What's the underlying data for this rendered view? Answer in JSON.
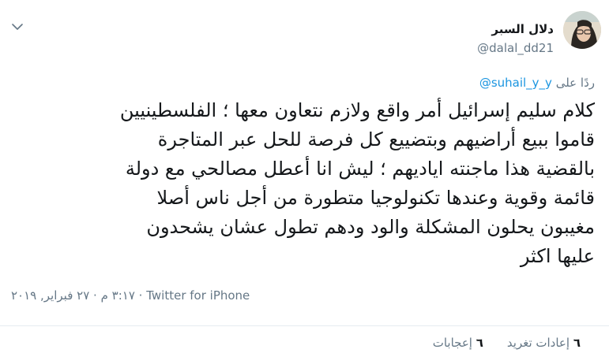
{
  "author": {
    "display_name": "دلال السبر",
    "handle": "@dalal_dd21",
    "avatar_icon": "profile-photo"
  },
  "reply": {
    "prefix": "ردًا على",
    "mention": "@suhail_y_y"
  },
  "tweet": {
    "lines": [
      "كلام سليم إسرائيل أمر واقع ولازم نتعاون معها ؛ الفلسطينيين",
      "قاموا ببيع أراضيهم وبتضييع كل فرصة للحل عبر المتاجرة",
      "بالقضية هذا ماجنته اياديهم ؛ ليش انا أعطل مصالحي مع دولة",
      "قائمة وقوية وعندها تكنولوجيا متطورة من أجل ناس أصلا",
      "مغيبون يحلون المشكلة والود ودهم تطول عشان يشحدون",
      "عليها اكثر"
    ]
  },
  "meta": {
    "time": "٣:١٧ م",
    "separator": " · ",
    "date": "٢٧ فبراير, ٢٠١٩",
    "source": "Twitter for iPhone"
  },
  "stats": {
    "retweets_count": "٦",
    "retweets_label": "إعادات تغريد",
    "likes_count": "٦",
    "likes_label": "إعجابات"
  },
  "colors": {
    "link": "#1b95e0",
    "muted": "#657786",
    "text": "#14171a",
    "divider": "#e6ecf0"
  },
  "icons": {
    "caret": "chevron-down-icon"
  }
}
